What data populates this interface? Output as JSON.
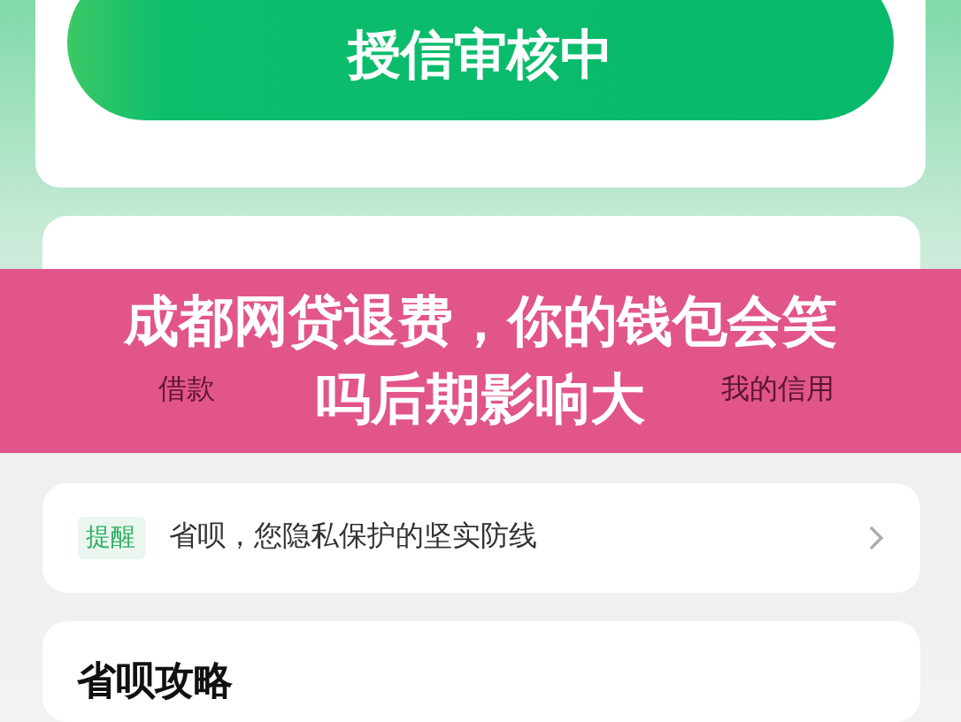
{
  "status_card": {
    "button": "授信审核中"
  },
  "shortcuts": [
    {
      "label": "借款"
    },
    {
      "label": "我的信用"
    }
  ],
  "notice": {
    "tag": "提醒",
    "text": "省呗，您隐私保护的坚实防线"
  },
  "guide": {
    "title": "省呗攻略"
  },
  "banner": {
    "title_lines": [
      "成都网贷退费，你的钱包会笑",
      "吗后期影响大"
    ]
  }
}
